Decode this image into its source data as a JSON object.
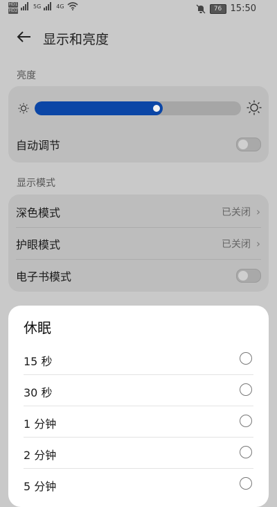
{
  "status_bar": {
    "sim1": "HD1",
    "sim2": "HD2",
    "signal1": "5G",
    "signal2": "4G",
    "battery": "76",
    "time": "15:50"
  },
  "header": {
    "title": "显示和亮度"
  },
  "brightness": {
    "section_label": "亮度",
    "level": 0.62,
    "auto_label": "自动调节",
    "auto_enabled": false
  },
  "display_mode": {
    "section_label": "显示模式",
    "items": [
      {
        "label": "深色模式",
        "value": "已关闭"
      },
      {
        "label": "护眼模式",
        "value": "已关闭"
      },
      {
        "label": "电子书模式",
        "enabled": false
      }
    ]
  },
  "sleep_sheet": {
    "title": "休眠",
    "options": [
      {
        "label": "15 秒",
        "selected": false
      },
      {
        "label": "30 秒",
        "selected": false
      },
      {
        "label": "1 分钟",
        "selected": false
      },
      {
        "label": "2 分钟",
        "selected": false
      },
      {
        "label": "5 分钟",
        "selected": false
      }
    ]
  },
  "colors": {
    "slider_fill": "#0b46a6",
    "sheet_bg": "#ffffff",
    "scrim": "#c9c9c9"
  }
}
